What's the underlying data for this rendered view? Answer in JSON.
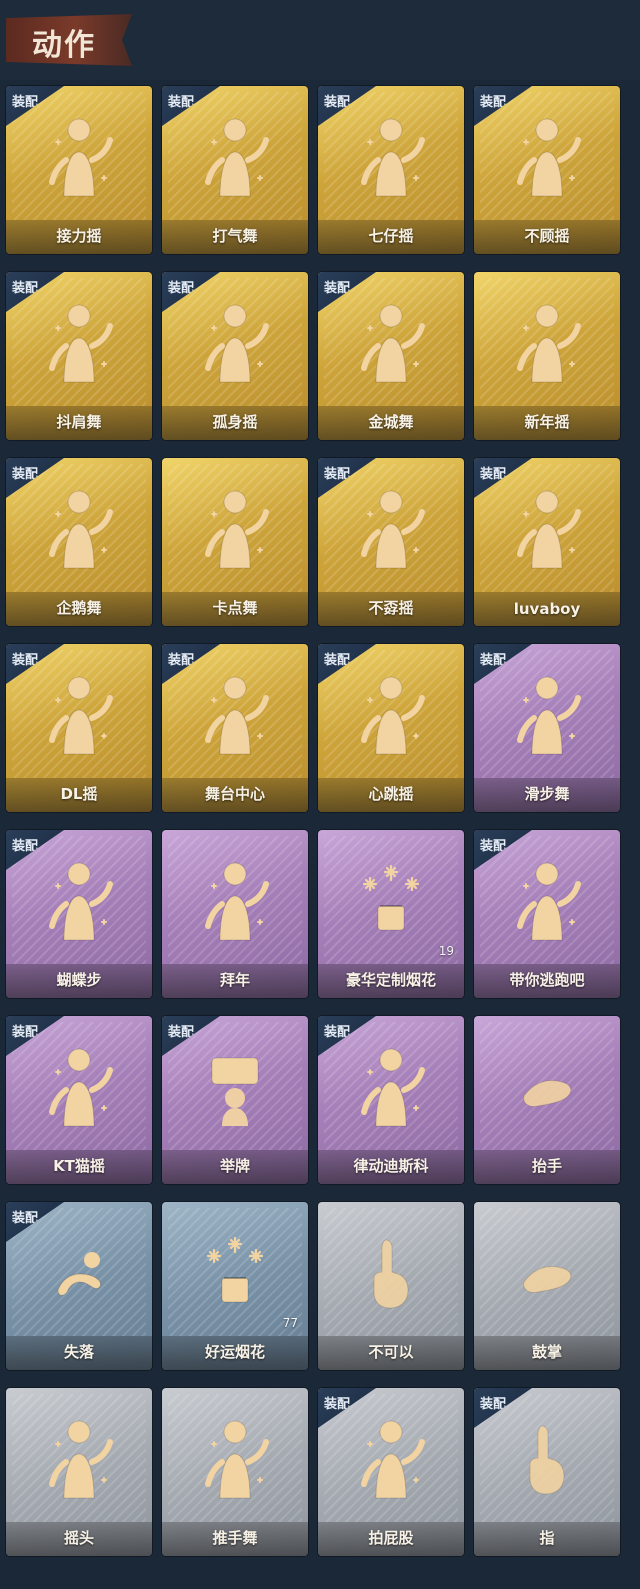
{
  "header": {
    "title": "动作"
  },
  "equip_badge": "装配",
  "cards": [
    {
      "label": "接力摇",
      "tier": "gold",
      "equipped": true,
      "icon": "dance-figure-icon"
    },
    {
      "label": "打气舞",
      "tier": "gold",
      "equipped": true,
      "icon": "dance-figure-icon"
    },
    {
      "label": "七仔摇",
      "tier": "gold",
      "equipped": true,
      "icon": "dance-figure-icon"
    },
    {
      "label": "不顾摇",
      "tier": "gold",
      "equipped": true,
      "icon": "dance-figure-icon"
    },
    {
      "label": "抖肩舞",
      "tier": "gold",
      "equipped": true,
      "icon": "dance-figure-icon"
    },
    {
      "label": "孤身摇",
      "tier": "gold",
      "equipped": true,
      "icon": "dance-figure-icon"
    },
    {
      "label": "金城舞",
      "tier": "gold",
      "equipped": true,
      "icon": "dance-figure-icon"
    },
    {
      "label": "新年摇",
      "tier": "gold",
      "equipped": false,
      "icon": "dance-figure-icon"
    },
    {
      "label": "企鹅舞",
      "tier": "gold",
      "equipped": true,
      "icon": "dance-figure-icon"
    },
    {
      "label": "卡点舞",
      "tier": "gold",
      "equipped": false,
      "icon": "dance-figure-icon"
    },
    {
      "label": "不孬摇",
      "tier": "gold",
      "equipped": true,
      "icon": "dance-figure-icon"
    },
    {
      "label": "luvaboy",
      "tier": "gold",
      "equipped": true,
      "icon": "dance-figure-icon"
    },
    {
      "label": "DL摇",
      "tier": "gold",
      "equipped": true,
      "icon": "dance-figure-icon"
    },
    {
      "label": "舞台中心",
      "tier": "gold",
      "equipped": true,
      "icon": "dance-figure-icon"
    },
    {
      "label": "心跳摇",
      "tier": "gold",
      "equipped": true,
      "icon": "dance-figure-icon"
    },
    {
      "label": "滑步舞",
      "tier": "purple",
      "equipped": true,
      "icon": "dance-figure-icon"
    },
    {
      "label": "蝴蝶步",
      "tier": "purple",
      "equipped": true,
      "icon": "dance-figure-icon"
    },
    {
      "label": "拜年",
      "tier": "purple",
      "equipped": false,
      "icon": "greeting-figure-icon"
    },
    {
      "label": "豪华定制烟花",
      "tier": "purple",
      "equipped": false,
      "icon": "fireworks-icon",
      "count": "19"
    },
    {
      "label": "带你逃跑吧",
      "tier": "purple",
      "equipped": true,
      "icon": "dance-figure-icon"
    },
    {
      "label": "KT猫摇",
      "tier": "purple",
      "equipped": true,
      "icon": "dance-figure-icon"
    },
    {
      "label": "举牌",
      "tier": "purple",
      "equipped": true,
      "icon": "sign-figure-icon"
    },
    {
      "label": "律动迪斯科",
      "tier": "purple",
      "equipped": true,
      "icon": "dance-figure-icon"
    },
    {
      "label": "抬手",
      "tier": "purple",
      "equipped": false,
      "icon": "hand-icon"
    },
    {
      "label": "失落",
      "tier": "blue",
      "equipped": true,
      "icon": "crawling-figure-icon"
    },
    {
      "label": "好运烟花",
      "tier": "blue",
      "equipped": false,
      "icon": "fireworks-icon",
      "count": "77"
    },
    {
      "label": "不可以",
      "tier": "gray",
      "equipped": false,
      "icon": "finger-icon"
    },
    {
      "label": "鼓掌",
      "tier": "gray",
      "equipped": false,
      "icon": "clap-icon"
    },
    {
      "label": "摇头",
      "tier": "gray",
      "equipped": false,
      "icon": "dance-figure-icon"
    },
    {
      "label": "推手舞",
      "tier": "gray",
      "equipped": false,
      "icon": "dance-figure-icon"
    },
    {
      "label": "拍屁股",
      "tier": "gray",
      "equipped": true,
      "icon": "dance-figure-icon"
    },
    {
      "label": "指",
      "tier": "gray",
      "equipped": true,
      "icon": "pointing-hand-icon"
    }
  ]
}
